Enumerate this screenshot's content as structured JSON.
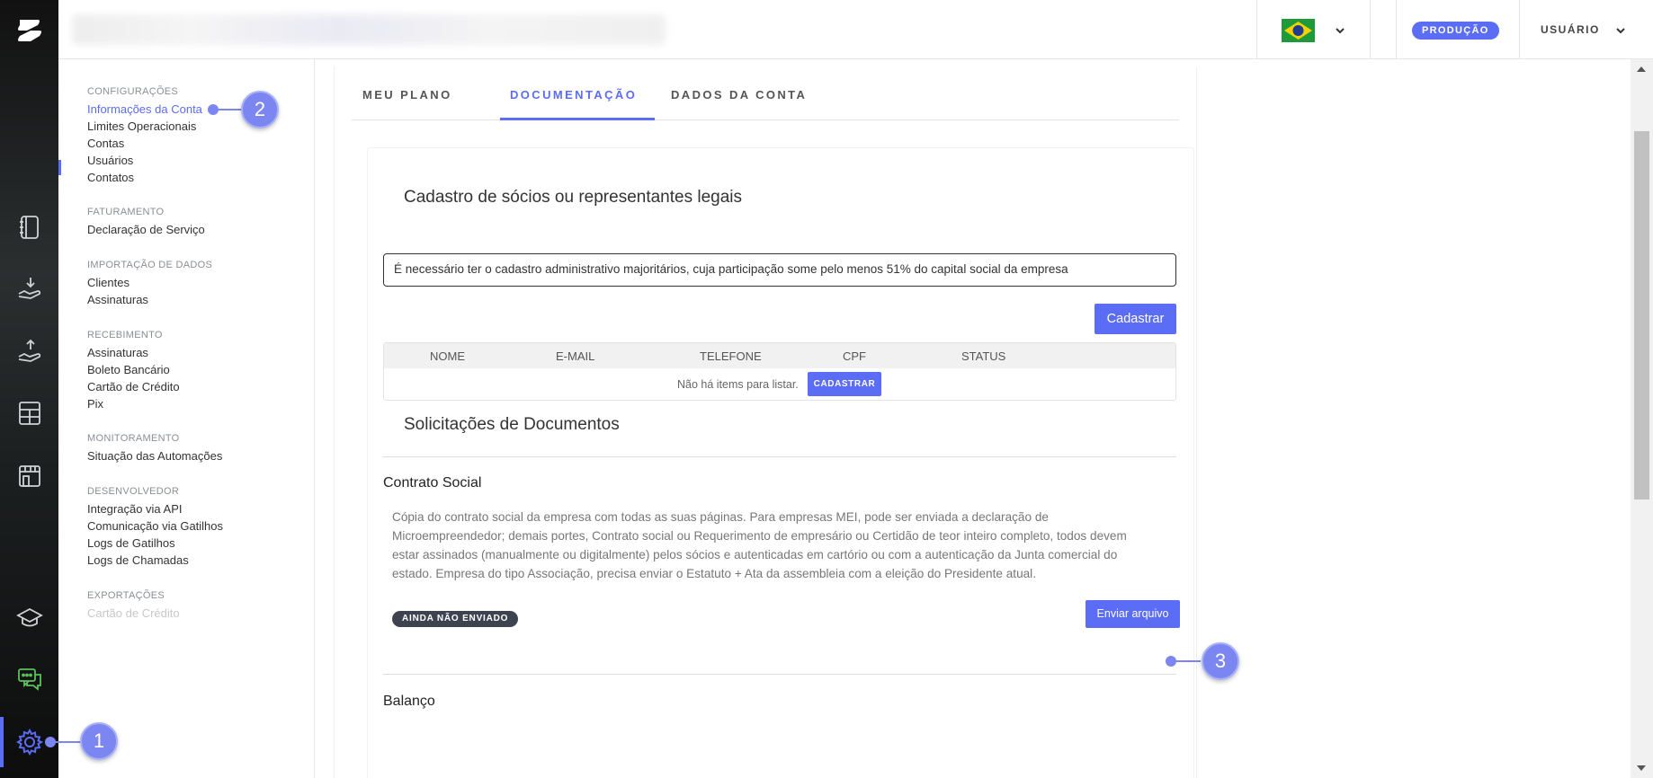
{
  "topbar": {
    "environment_badge": "PRODUÇÃO",
    "user_menu_label": "USUÁRIO"
  },
  "sidebar": {
    "groups": [
      {
        "header": "CONFIGURAÇÕES",
        "items": [
          "Informações da Conta",
          "Limites Operacionais",
          "Contas",
          "Usuários",
          "Contatos"
        ]
      },
      {
        "header": "FATURAMENTO",
        "items": [
          "Declaração de Serviço"
        ]
      },
      {
        "header": "IMPORTAÇÃO DE DADOS",
        "items": [
          "Clientes",
          "Assinaturas"
        ]
      },
      {
        "header": "RECEBIMENTO",
        "items": [
          "Assinaturas",
          "Boleto Bancário",
          "Cartão de Crédito",
          "Pix"
        ]
      },
      {
        "header": "MONITORAMENTO",
        "items": [
          "Situação das Automações"
        ]
      },
      {
        "header": "DESENVOLVEDOR",
        "items": [
          "Integração via API",
          "Comunicação via Gatilhos",
          "Logs de Gatilhos",
          "Logs de Chamadas"
        ]
      },
      {
        "header": "EXPORTAÇÕES",
        "items": [
          "Cartão de Crédito"
        ]
      }
    ],
    "active_item": "Informações da Conta"
  },
  "tabs": [
    "MEU PLANO",
    "DOCUMENTAÇÃO",
    "DADOS DA CONTA"
  ],
  "active_tab": "DOCUMENTAÇÃO",
  "partners": {
    "title": "Cadastro de sócios ou representantes legais",
    "notice": "É necessário ter o cadastro administrativo majoritários, cuja participação some pelo menos 51% do capital social da empresa",
    "register_button": "Cadastrar",
    "columns": [
      "NOME",
      "E-MAIL",
      "TELEFONE",
      "CPF",
      "STATUS"
    ],
    "empty_text": "Não há items para listar.",
    "empty_button": "CADASTRAR"
  },
  "documents": {
    "title": "Solicitações de Documentos",
    "items": [
      {
        "name": "Contrato Social",
        "description": "Cópia do contrato social da empresa com todas as suas páginas. Para empresas MEI, pode ser enviada a declaração de Microempreendedor; demais portes, Contrato social ou Requerimento de empresário ou Certidão de teor inteiro completo, todos devem estar assinados (manualmente ou digitalmente) pelos sócios e autenticadas em cartório ou com a autenticação da Junta comercial do estado. Empresa do tipo Associação, precisa enviar o Estatuto + Ata da assembleia com a eleição do Presidente atual.",
        "status": "AINDA NÃO ENVIADO",
        "upload_button": "Enviar arquivo"
      },
      {
        "name": "Balanço"
      }
    ]
  },
  "callouts": [
    "1",
    "2",
    "3"
  ],
  "colors": {
    "accent": "#5b6cf5",
    "callout": "#7b86f0",
    "status_dark": "#3d4450"
  },
  "icons": [
    "logo-icon",
    "notebook-icon",
    "hand-download-icon",
    "hand-upload-icon",
    "calculator-icon",
    "store-icon",
    "graduation-cap-icon",
    "chat-icon",
    "gear-icon",
    "brazil-flag-icon",
    "chevron-down-icon"
  ]
}
